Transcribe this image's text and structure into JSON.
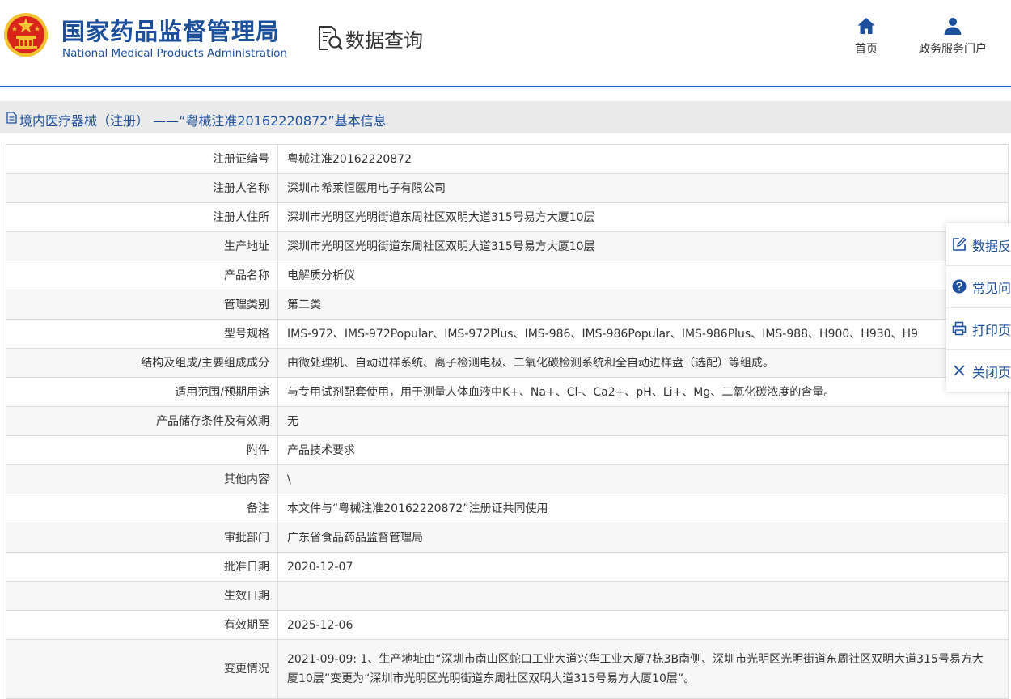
{
  "header": {
    "logo_cn": "国家药品监督管理局",
    "logo_en": "National Medical Products Administration",
    "section_title": "数据查询",
    "nav": [
      {
        "label": "首页",
        "icon": "home-icon"
      },
      {
        "label": "政务服务门户",
        "icon": "user-icon"
      }
    ]
  },
  "page": {
    "title": "境内医疗器械（注册） ——“粤械注准20162220872”基本信息"
  },
  "table": {
    "rows": [
      {
        "label": "注册证编号",
        "value": "粤械注准20162220872"
      },
      {
        "label": "注册人名称",
        "value": "深圳市希莱恒医用电子有限公司"
      },
      {
        "label": "注册人住所",
        "value": "深圳市光明区光明街道东周社区双明大道315号易方大厦10层"
      },
      {
        "label": "生产地址",
        "value": "深圳市光明区光明街道东周社区双明大道315号易方大厦10层"
      },
      {
        "label": "产品名称",
        "value": "电解质分析仪"
      },
      {
        "label": "管理类别",
        "value": "第二类"
      },
      {
        "label": "型号规格",
        "value": "IMS-972、IMS-972Popular、IMS-972Plus、IMS-986、IMS-986Popular、IMS-986Plus、IMS-988、H900、H930、H9"
      },
      {
        "label": "结构及组成/主要组成成分",
        "value": "由微处理机、自动进样系统、离子检测电极、二氧化碳检测系统和全自动进样盘（选配）等组成。"
      },
      {
        "label": "适用范围/预期用途",
        "value": "与专用试剂配套使用，用于测量人体血液中K+、Na+、Cl-、Ca2+、pH、Li+、Mg、二氧化碳浓度的含量。"
      },
      {
        "label": "产品储存条件及有效期",
        "value": "无"
      },
      {
        "label": "附件",
        "value": "产品技术要求"
      },
      {
        "label": "其他内容",
        "value": "\\"
      },
      {
        "label": "备注",
        "value": "本文件与“粤械注准20162220872”注册证共同使用"
      },
      {
        "label": "审批部门",
        "value": "广东省食品药品监督管理局"
      },
      {
        "label": "批准日期",
        "value": "2020-12-07"
      },
      {
        "label": "生效日期",
        "value": ""
      },
      {
        "label": "有效期至",
        "value": "2025-12-06"
      },
      {
        "label": "变更情况",
        "value": "2021-09-09: 1、生产地址由“深圳市南山区蛇口工业大道兴华工业大厦7栋3B南侧、深圳市光明区光明街道东周社区双明大道315号易方大厦10层”变更为“深圳市光明区光明街道东周社区双明大道315号易方大厦10层”。"
      }
    ]
  },
  "side_panel": {
    "items": [
      {
        "label": "数据反",
        "icon": "edit-icon"
      },
      {
        "label": "常见问",
        "icon": "help-icon"
      },
      {
        "label": "打印页",
        "icon": "print-icon"
      },
      {
        "label": "关闭页",
        "icon": "close-icon"
      }
    ]
  },
  "colors": {
    "brand_blue": "#1c4f9c",
    "emblem_red": "#d9261c",
    "emblem_gold": "#f2c230",
    "title_bar_bg": "#eaeaea"
  }
}
